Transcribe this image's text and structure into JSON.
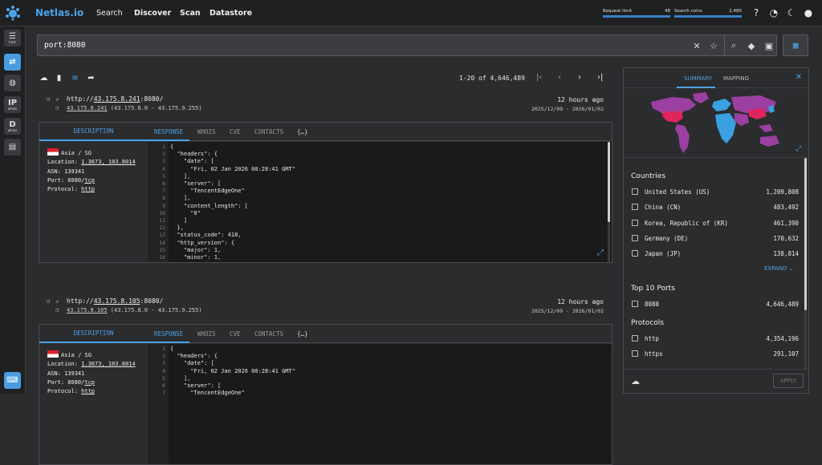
{
  "topbar": {
    "brand": "Netlas.io",
    "nav": [
      "Search",
      "Discover",
      "Scan",
      "Datastore"
    ],
    "request_limit": {
      "label": "Request limit",
      "value": "48"
    },
    "search_coins": {
      "label": "Search coins",
      "value": "2,480"
    },
    "icons": [
      "help-icon",
      "speed-icon",
      "theme-icon",
      "user-icon"
    ]
  },
  "rail": {
    "items": [
      {
        "name": "host",
        "big": "",
        "small": "host"
      },
      {
        "name": "responses",
        "big": "",
        "small": ""
      },
      {
        "name": "domains",
        "big": "",
        "small": ""
      },
      {
        "name": "ip-whois",
        "big": "IP",
        "small": "whois"
      },
      {
        "name": "domain-whois",
        "big": "D",
        "small": "whois"
      },
      {
        "name": "certificates",
        "big": "",
        "small": ""
      }
    ]
  },
  "search": {
    "value": "port:8080",
    "placeholder": ""
  },
  "toolbar": {
    "pagination": "1-20 of 4,646,489"
  },
  "results": [
    {
      "url_prefix": "http://",
      "url_host": "43.175.8.241",
      "url_suffix": ":8080/",
      "ip": "43.175.8.241",
      "ip_range": " (43.175.8.0 - 43.175.9.255)",
      "time": "12 hours ago",
      "range": "2025/12/09 - 2026/01/02",
      "tabs": {
        "description": "DESCRIPTION",
        "response": "RESPONSE",
        "whois": "WHOIS",
        "cve": "CVE",
        "contacts": "CONTACTS",
        "raw": "{…}"
      },
      "info": {
        "region": "Asia / SG",
        "location_label": "Location: ",
        "location": "1.3673, 103.8014",
        "asn": "ASN: 139341",
        "port_label": "Port: 8080/",
        "port_proto": "tcp",
        "protocol_label": "Protocol: ",
        "protocol": "http"
      }
    },
    {
      "url_prefix": "http://",
      "url_host": "43.175.8.105",
      "url_suffix": ":8080/",
      "ip": "43.175.8.105",
      "ip_range": " (43.175.8.0 - 43.175.9.255)",
      "time": "12 hours ago",
      "range": "2025/12/09 - 2026/01/02",
      "tabs": {
        "description": "DESCRIPTION",
        "response": "RESPONSE",
        "whois": "WHOIS",
        "cve": "CVE",
        "contacts": "CONTACTS",
        "raw": "{…}"
      },
      "info": {
        "region": "Asia / SG",
        "location_label": "Location: ",
        "location": "1.3673, 103.8014",
        "asn": "ASN: 139341",
        "port_label": "Port: 8080/",
        "port_proto": "tcp",
        "protocol_label": "Protocol: ",
        "protocol": "http"
      }
    }
  ],
  "code1": [
    {
      "n": "1",
      "t": "{"
    },
    {
      "n": "2",
      "t": "  \"headers\": {"
    },
    {
      "n": "3",
      "t": "    \"date\": ["
    },
    {
      "n": "4",
      "t": "      \"Fri, 02 Jan 2026 00:28:41 GMT\""
    },
    {
      "n": "5",
      "t": "    ],"
    },
    {
      "n": "6",
      "t": "    \"server\": ["
    },
    {
      "n": "7",
      "t": "      \"TencentEdgeOne\""
    },
    {
      "n": "8",
      "t": "    ],"
    },
    {
      "n": "9",
      "t": "    \"content_length\": ["
    },
    {
      "n": "10",
      "t": "      \"0\""
    },
    {
      "n": "11",
      "t": "    ]"
    },
    {
      "n": "12",
      "t": "  },"
    },
    {
      "n": "13",
      "t": "  \"status_code\": 418,"
    },
    {
      "n": "14",
      "t": "  \"http_version\": {"
    },
    {
      "n": "15",
      "t": "    \"major\": 1,"
    },
    {
      "n": "16",
      "t": "    \"minor\": 1,"
    }
  ],
  "code2": [
    {
      "n": "1",
      "t": "{"
    },
    {
      "n": "2",
      "t": "  \"headers\": {"
    },
    {
      "n": "3",
      "t": "    \"date\": ["
    },
    {
      "n": "4",
      "t": "      \"Fri, 02 Jan 2026 00:28:41 GMT\""
    },
    {
      "n": "5",
      "t": "    ],"
    },
    {
      "n": "6",
      "t": "    \"server\": ["
    },
    {
      "n": "7",
      "t": "      \"TencentEdgeOne\""
    }
  ],
  "panel": {
    "tabs": [
      "SUMMARY",
      "MAPPING"
    ],
    "countries_title": "Countries",
    "countries": [
      {
        "label": "United States (US)",
        "count": "1,209,808"
      },
      {
        "label": "China (CN)",
        "count": "483,492"
      },
      {
        "label": "Korea, Republic of (KR)",
        "count": "461,390"
      },
      {
        "label": "Germany (DE)",
        "count": "170,632"
      },
      {
        "label": "Japan (JP)",
        "count": "138,814"
      }
    ],
    "expand": "EXPAND",
    "ports_title": "Top 10 Ports",
    "ports": [
      {
        "label": "8080",
        "count": "4,646,489"
      }
    ],
    "protocols_title": "Protocols",
    "protocols": [
      {
        "label": "http",
        "count": "4,354,196"
      },
      {
        "label": "https",
        "count": "291,107"
      }
    ],
    "apply": "APPLY"
  }
}
